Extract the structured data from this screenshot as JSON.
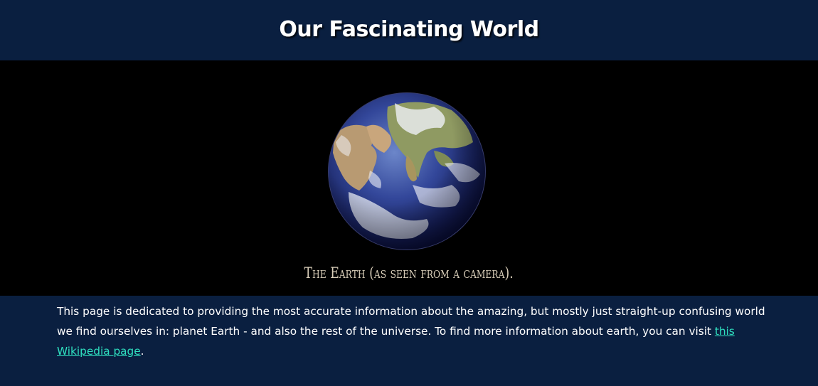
{
  "header": {
    "title": "Our Fascinating World"
  },
  "hero": {
    "image_subject": "earth-globe",
    "caption": "The Earth (as seen from a camera)."
  },
  "intro": {
    "text_before_link": "This page is dedicated to providing the most accurate information about the amazing, but mostly just straight-up confusing world we find ourselves in: planet Earth - and also the rest of the universe. To find more information about earth, you can visit ",
    "link_label": "this Wikipedia page",
    "text_after_link": "."
  },
  "colors": {
    "page_background": "#0a1f40",
    "hero_background": "#000000",
    "link": "#2fe0c0",
    "caption": "#d8cdb8"
  }
}
